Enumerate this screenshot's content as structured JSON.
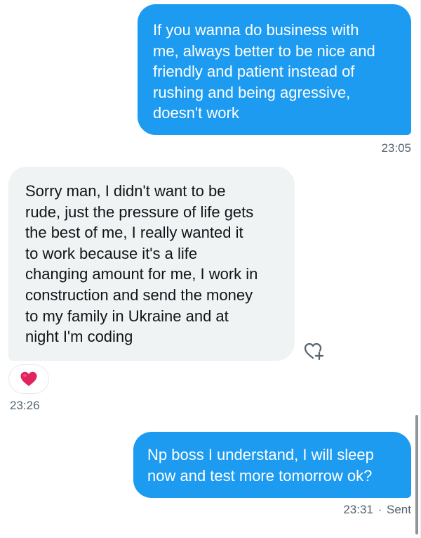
{
  "messages": [
    {
      "direction": "outgoing",
      "text": "If you wanna do business with\nme, always better to be nice and\nfriendly and patient instead of\nrushing and being agressive,\ndoesn't work",
      "time": "23:05"
    },
    {
      "direction": "incoming",
      "text": "Sorry man, I didn't want to be\nrude, just the pressure of life gets\nthe best of me, I really wanted it\nto work because it's a life\nchanging amount for me, I work in\nconstruction and send the money\nto my family in Ukraine and at\nnight I'm coding",
      "time": "23:26",
      "reaction": "red-heart-emoji"
    },
    {
      "direction": "outgoing",
      "text": "Np boss I understand, I will sleep\nnow and test more tomorrow ok?",
      "time": "23:31",
      "separator": "·",
      "status": "Sent"
    }
  ],
  "icons": {
    "add_reaction": "heart-plus-icon",
    "reaction": "red-heart-emoji"
  },
  "colors": {
    "outgoing_bubble": "#1d9bf0",
    "incoming_bubble": "#eff3f4",
    "timestamp": "#536471",
    "reaction_heart": "#e0245e"
  }
}
